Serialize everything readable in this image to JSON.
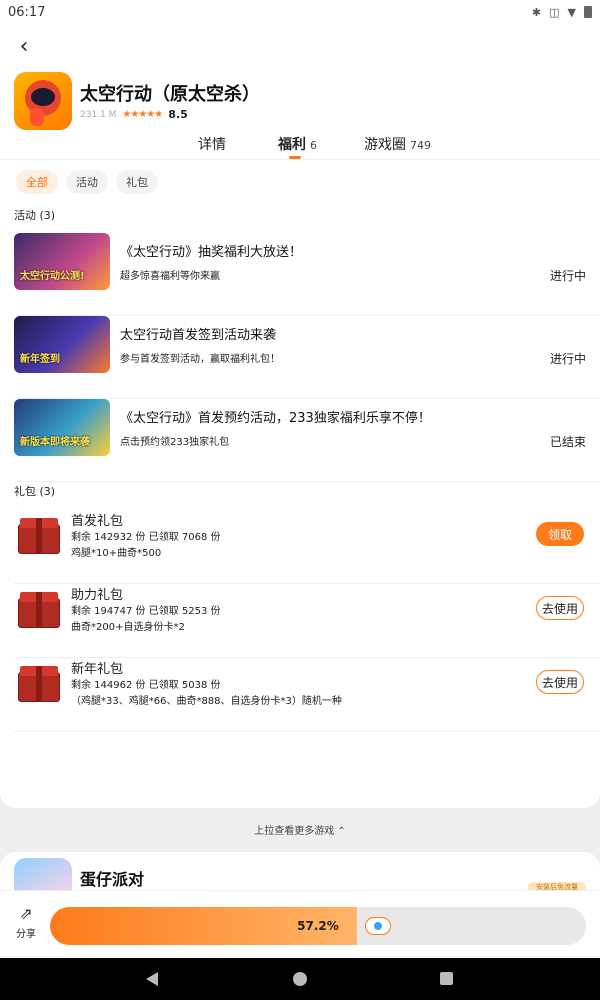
{
  "status_bar": {
    "time": "06:17"
  },
  "app": {
    "title": "太空行动（原太空杀）",
    "size": "231.1 M",
    "stars": "★★★★★",
    "rating": "8.5"
  },
  "tabs": [
    {
      "label": "详情",
      "count": ""
    },
    {
      "label": "福利",
      "count": "6"
    },
    {
      "label": "游戏圈",
      "count": "749"
    }
  ],
  "filters": [
    "全部",
    "活动",
    "礼包"
  ],
  "activities_section": {
    "label": "活动 (3)"
  },
  "activities": [
    {
      "thumb_text": "太空行动公测!",
      "title": "《太空行动》抽奖福利大放送！",
      "subtitle": "超多惊喜福利等你来赢",
      "status": "进行中"
    },
    {
      "thumb_text": "新年签到",
      "title": "太空行动首发签到活动来袭",
      "subtitle": "参与首发签到活动，赢取福利礼包！",
      "status": "进行中"
    },
    {
      "thumb_text": "新版本即将来袭",
      "title": "《太空行动》首发预约活动，233独家福利乐享不停！",
      "subtitle": "点击预约领233独家礼包",
      "status": "已结束"
    }
  ],
  "gifts_section": {
    "label": "礼包 (3)"
  },
  "gifts": [
    {
      "name": "首发礼包",
      "line1": "剩余 142932 份 已领取 7068 份",
      "line2": "鸡腿*10+曲奇*500",
      "button": "领取"
    },
    {
      "name": "助力礼包",
      "line1": "剩余 194747 份 已领取 5253 份",
      "line2": "曲奇*200+自选身份卡*2",
      "button": "去使用"
    },
    {
      "name": "新年礼包",
      "line1": "剩余 144962 份 已领取 5038 份",
      "line2": "（鸡腿*33、鸡腿*66、曲奇*888、自选身份卡*3）随机一种",
      "button": "去使用"
    }
  ],
  "more_games": "上拉查看更多游戏 ⌃",
  "next_game": {
    "title": "蛋仔派对",
    "tag": "安装后免流量"
  },
  "bottom": {
    "share_label": "分享",
    "progress_text": "57.2%",
    "progress_fraction": 0.572
  },
  "colors": {
    "accent": "#ff7a1a",
    "chip_active_bg": "#ffefe3"
  }
}
